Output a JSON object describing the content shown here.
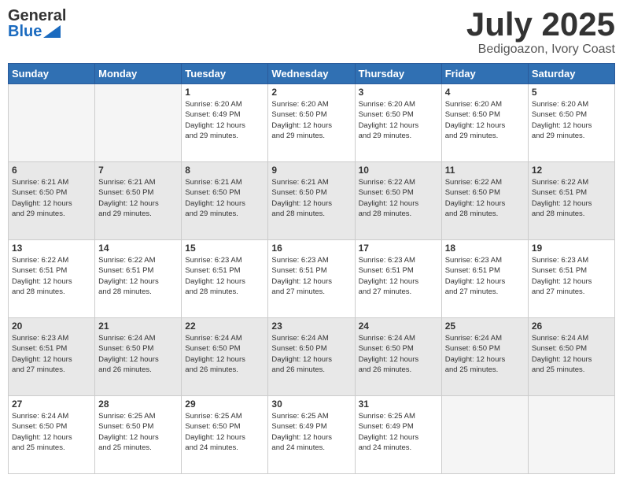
{
  "logo": {
    "text_general": "General",
    "text_blue": "Blue"
  },
  "title": {
    "month_year": "July 2025",
    "location": "Bedigoazon, Ivory Coast"
  },
  "days_of_week": [
    "Sunday",
    "Monday",
    "Tuesday",
    "Wednesday",
    "Thursday",
    "Friday",
    "Saturday"
  ],
  "weeks": [
    [
      {
        "day": "",
        "empty": true
      },
      {
        "day": "",
        "empty": true
      },
      {
        "day": "1",
        "sunrise": "6:20 AM",
        "sunset": "6:49 PM",
        "daylight": "12 hours and 29 minutes."
      },
      {
        "day": "2",
        "sunrise": "6:20 AM",
        "sunset": "6:50 PM",
        "daylight": "12 hours and 29 minutes."
      },
      {
        "day": "3",
        "sunrise": "6:20 AM",
        "sunset": "6:50 PM",
        "daylight": "12 hours and 29 minutes."
      },
      {
        "day": "4",
        "sunrise": "6:20 AM",
        "sunset": "6:50 PM",
        "daylight": "12 hours and 29 minutes."
      },
      {
        "day": "5",
        "sunrise": "6:20 AM",
        "sunset": "6:50 PM",
        "daylight": "12 hours and 29 minutes."
      }
    ],
    [
      {
        "day": "6",
        "sunrise": "6:21 AM",
        "sunset": "6:50 PM",
        "daylight": "12 hours and 29 minutes."
      },
      {
        "day": "7",
        "sunrise": "6:21 AM",
        "sunset": "6:50 PM",
        "daylight": "12 hours and 29 minutes."
      },
      {
        "day": "8",
        "sunrise": "6:21 AM",
        "sunset": "6:50 PM",
        "daylight": "12 hours and 29 minutes."
      },
      {
        "day": "9",
        "sunrise": "6:21 AM",
        "sunset": "6:50 PM",
        "daylight": "12 hours and 28 minutes."
      },
      {
        "day": "10",
        "sunrise": "6:22 AM",
        "sunset": "6:50 PM",
        "daylight": "12 hours and 28 minutes."
      },
      {
        "day": "11",
        "sunrise": "6:22 AM",
        "sunset": "6:50 PM",
        "daylight": "12 hours and 28 minutes."
      },
      {
        "day": "12",
        "sunrise": "6:22 AM",
        "sunset": "6:51 PM",
        "daylight": "12 hours and 28 minutes."
      }
    ],
    [
      {
        "day": "13",
        "sunrise": "6:22 AM",
        "sunset": "6:51 PM",
        "daylight": "12 hours and 28 minutes."
      },
      {
        "day": "14",
        "sunrise": "6:22 AM",
        "sunset": "6:51 PM",
        "daylight": "12 hours and 28 minutes."
      },
      {
        "day": "15",
        "sunrise": "6:23 AM",
        "sunset": "6:51 PM",
        "daylight": "12 hours and 28 minutes."
      },
      {
        "day": "16",
        "sunrise": "6:23 AM",
        "sunset": "6:51 PM",
        "daylight": "12 hours and 27 minutes."
      },
      {
        "day": "17",
        "sunrise": "6:23 AM",
        "sunset": "6:51 PM",
        "daylight": "12 hours and 27 minutes."
      },
      {
        "day": "18",
        "sunrise": "6:23 AM",
        "sunset": "6:51 PM",
        "daylight": "12 hours and 27 minutes."
      },
      {
        "day": "19",
        "sunrise": "6:23 AM",
        "sunset": "6:51 PM",
        "daylight": "12 hours and 27 minutes."
      }
    ],
    [
      {
        "day": "20",
        "sunrise": "6:23 AM",
        "sunset": "6:51 PM",
        "daylight": "12 hours and 27 minutes."
      },
      {
        "day": "21",
        "sunrise": "6:24 AM",
        "sunset": "6:50 PM",
        "daylight": "12 hours and 26 minutes."
      },
      {
        "day": "22",
        "sunrise": "6:24 AM",
        "sunset": "6:50 PM",
        "daylight": "12 hours and 26 minutes."
      },
      {
        "day": "23",
        "sunrise": "6:24 AM",
        "sunset": "6:50 PM",
        "daylight": "12 hours and 26 minutes."
      },
      {
        "day": "24",
        "sunrise": "6:24 AM",
        "sunset": "6:50 PM",
        "daylight": "12 hours and 26 minutes."
      },
      {
        "day": "25",
        "sunrise": "6:24 AM",
        "sunset": "6:50 PM",
        "daylight": "12 hours and 25 minutes."
      },
      {
        "day": "26",
        "sunrise": "6:24 AM",
        "sunset": "6:50 PM",
        "daylight": "12 hours and 25 minutes."
      }
    ],
    [
      {
        "day": "27",
        "sunrise": "6:24 AM",
        "sunset": "6:50 PM",
        "daylight": "12 hours and 25 minutes."
      },
      {
        "day": "28",
        "sunrise": "6:25 AM",
        "sunset": "6:50 PM",
        "daylight": "12 hours and 25 minutes."
      },
      {
        "day": "29",
        "sunrise": "6:25 AM",
        "sunset": "6:50 PM",
        "daylight": "12 hours and 24 minutes."
      },
      {
        "day": "30",
        "sunrise": "6:25 AM",
        "sunset": "6:49 PM",
        "daylight": "12 hours and 24 minutes."
      },
      {
        "day": "31",
        "sunrise": "6:25 AM",
        "sunset": "6:49 PM",
        "daylight": "12 hours and 24 minutes."
      },
      {
        "day": "",
        "empty": true
      },
      {
        "day": "",
        "empty": true
      }
    ]
  ],
  "labels": {
    "sunrise": "Sunrise:",
    "sunset": "Sunset:",
    "daylight": "Daylight:"
  }
}
